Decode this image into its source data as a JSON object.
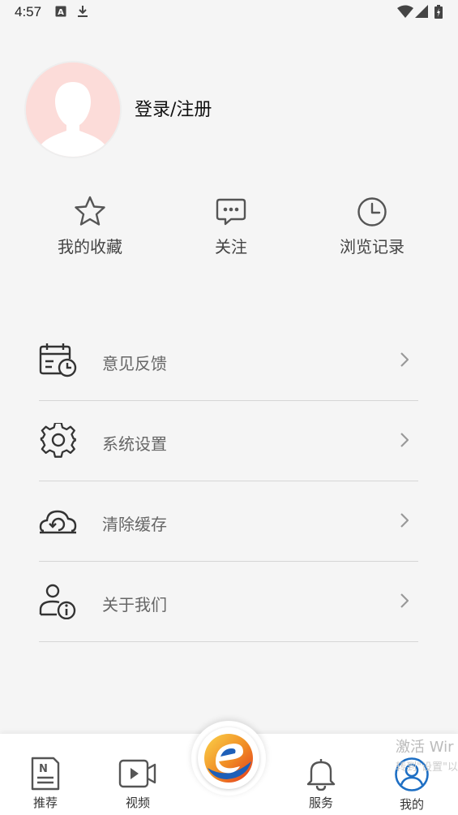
{
  "status_bar": {
    "time": "4:57",
    "left_icons": [
      "text-a-icon",
      "download-icon"
    ],
    "right_icons": [
      "wifi-icon",
      "signal-icon",
      "battery-icon"
    ]
  },
  "profile": {
    "login_label": "登录/注册"
  },
  "quick_actions": [
    {
      "icon": "star-icon",
      "label": "我的收藏"
    },
    {
      "icon": "chat-bubble-icon",
      "label": "关注"
    },
    {
      "icon": "clock-icon",
      "label": "浏览记录"
    }
  ],
  "menu": [
    {
      "icon": "calendar-clock-icon",
      "label": "意见反馈"
    },
    {
      "icon": "gear-icon",
      "label": "系统设置"
    },
    {
      "icon": "cloud-refresh-icon",
      "label": "清除缓存"
    },
    {
      "icon": "user-info-icon",
      "label": "关于我们"
    }
  ],
  "tabbar": {
    "tabs": [
      {
        "icon": "news-icon",
        "label": "推荐"
      },
      {
        "icon": "video-icon",
        "label": "视频"
      },
      {
        "icon": "bell-icon",
        "label": "服务"
      },
      {
        "icon": "user-circle-icon",
        "label": "我的",
        "active": true
      }
    ],
    "active_color": "#1e6fc4"
  },
  "watermark": {
    "line1": "激活 Wir",
    "line2": "转到\"设置\"以"
  }
}
